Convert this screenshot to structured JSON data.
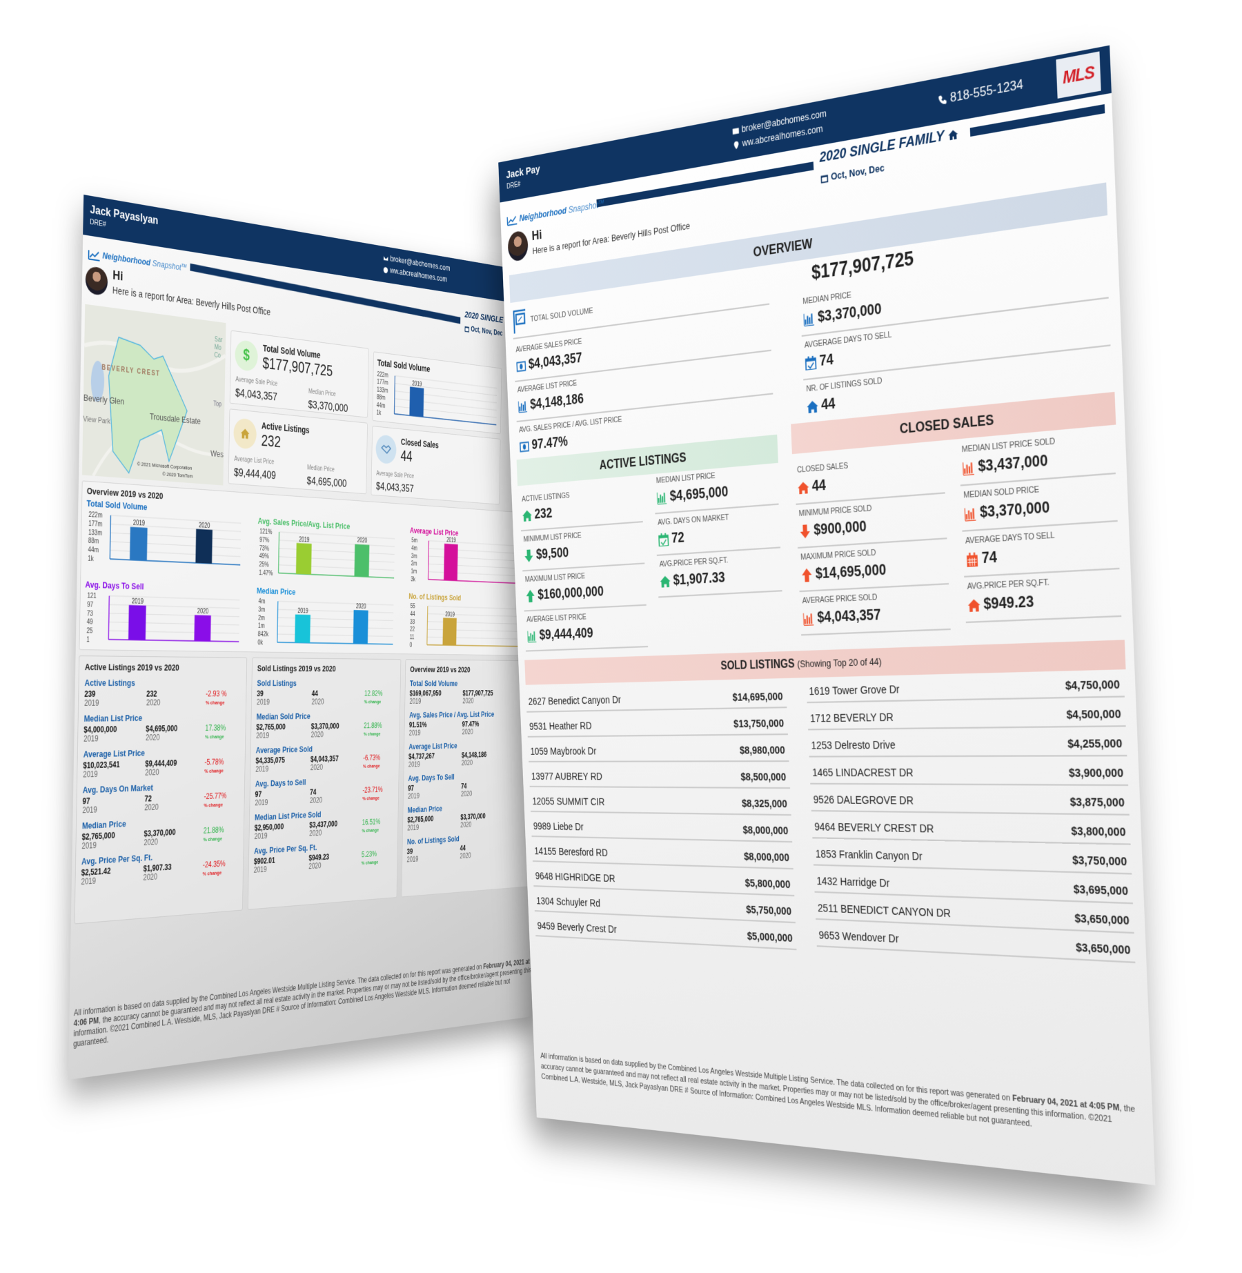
{
  "colors": {
    "navy": "#0f3462",
    "accent_blue": "#1a6fc0",
    "green": "#2bb673",
    "red": "#f0522d",
    "mls_red": "#d32027"
  },
  "left_doc": {
    "agent_name": "Jack Payaslyan",
    "dre": "DRE#",
    "email": "broker@abchomes.com",
    "website": "ww.abcrealhomes.com",
    "brand_a": "Neighborhood",
    "brand_b": "Snapshot",
    "brand_tm": "TM",
    "greeting": "Hi",
    "report_for": "Here is a report for Area: Beverly Hills Post Office",
    "report_title": "2020 SINGLE FAMIL",
    "period": "Oct, Nov, Dec",
    "map": {
      "labels": [
        "BEVERLY CREST",
        "Beverly Glen",
        "Trousdale Estate",
        "View Park",
        "Wes",
        "Top",
        "Sar",
        "Mo",
        "Co"
      ],
      "copyright_1": "© 2021 Microsoft Corporation",
      "copyright_2": "© 2020 TomTom"
    },
    "cards": {
      "total_sold": {
        "title": "Total Sold Volume",
        "value": "$177,907,725",
        "icon": "dollar",
        "sub": [
          {
            "label": "Average Sale Price",
            "value": "$4,043,357"
          },
          {
            "label": "Median Price",
            "value": "$3,370,000"
          }
        ]
      },
      "active": {
        "title": "Active Listings",
        "value": "232",
        "icon": "house",
        "sub": [
          {
            "label": "Average List Price",
            "value": "$9,444,409"
          },
          {
            "label": "Median Price",
            "value": "$4,695,000"
          }
        ]
      },
      "mini_chart": {
        "title": "Total Sold Volume",
        "ticks": [
          "222m",
          "177m",
          "133m",
          "88m",
          "44m",
          "1k"
        ],
        "ylim": [
          0,
          222000000
        ],
        "bars": [
          {
            "label": "2019",
            "value": 169067950,
            "color": "#1f5fae"
          }
        ]
      },
      "closed": {
        "title": "Closed Sales",
        "value": "44",
        "icon": "handshake",
        "sub": [
          {
            "label": "Average Sale Price",
            "value": "$4,043,357"
          }
        ]
      }
    },
    "charts": {
      "title": "Overview 2019 vs 2020",
      "items": [
        {
          "title": "Total Sold Volume",
          "color": "#1a6fc0",
          "ticks": [
            "222m",
            "177m",
            "133m",
            "88m",
            "44m",
            "1k"
          ],
          "ylim": [
            0,
            222000000
          ],
          "bars": [
            {
              "label": "2019",
              "value": 169067950,
              "color": "#2a78c2"
            },
            {
              "label": "2020",
              "value": 177907725,
              "color": "#0f2f57"
            }
          ]
        },
        {
          "title": "Avg. Sales Price/Avg. List Price",
          "color": "#4cbf6a",
          "ticks": [
            "121%",
            "97%",
            "73%",
            "49%",
            "25%",
            "1.47%"
          ],
          "ylim": [
            0,
            121
          ],
          "bars": [
            {
              "label": "2019",
              "value": 91.51,
              "color": "#9acd32"
            },
            {
              "label": "2020",
              "value": 97.47,
              "color": "#4cbf6a"
            }
          ]
        },
        {
          "title": "Average List Price",
          "color": "#d4109b",
          "ticks": [
            "5m",
            "4m",
            "3m",
            "2m",
            "1m",
            "3k"
          ],
          "ylim": [
            0,
            5000000
          ],
          "bars": [
            {
              "label": "2019",
              "value": 4737267,
              "color": "#d4109b"
            }
          ]
        },
        {
          "title": "Avg. Days To Sell",
          "color": "#8a0ee8",
          "ticks": [
            "121",
            "97",
            "73",
            "49",
            "25",
            "1"
          ],
          "ylim": [
            0,
            121
          ],
          "bars": [
            {
              "label": "2019",
              "value": 97,
              "color": "#7a0ee8"
            },
            {
              "label": "2020",
              "value": 74,
              "color": "#8a0ee8"
            }
          ]
        },
        {
          "title": "Median Price",
          "color": "#1a8fd8",
          "ticks": [
            "4m",
            "3m",
            "2m",
            "1m",
            "842k",
            "0k"
          ],
          "ylim": [
            0,
            4000000
          ],
          "bars": [
            {
              "label": "2019",
              "value": 2765000,
              "color": "#18c3d9"
            },
            {
              "label": "2020",
              "value": 3370000,
              "color": "#1a8fd8"
            }
          ]
        },
        {
          "title": "No. of Listings Sold",
          "color": "#c9a43b",
          "ticks": [
            "55",
            "44",
            "33",
            "22",
            "11",
            "0"
          ],
          "ylim": [
            0,
            55
          ],
          "bars": [
            {
              "label": "2019",
              "value": 39,
              "color": "#c9a43b"
            }
          ]
        }
      ]
    },
    "panels": [
      {
        "title": "Active Listings 2019 vs 2020",
        "rows": [
          {
            "label": "Active Listings",
            "a": "239",
            "b": "232",
            "change": "-2.93 %",
            "dir": "down"
          },
          {
            "label": "Median List Price",
            "a": "$4,000,000",
            "b": "$4,695,000",
            "change": "17.38%",
            "dir": "up"
          },
          {
            "label": "Average List Price",
            "a": "$10,023,541",
            "b": "$9,444,409",
            "change": "-5.78%",
            "dir": "down"
          },
          {
            "label": "Avg. Days On Market",
            "a": "97",
            "b": "72",
            "change": "-25.77%",
            "dir": "down"
          },
          {
            "label": "Median Price",
            "a": "$2,765,000",
            "b": "$3,370,000",
            "change": "21.88%",
            "dir": "up"
          },
          {
            "label": "Avg. Price Per Sq. Ft.",
            "a": "$2,521.42",
            "b": "$1,907.33",
            "change": "-24.35%",
            "dir": "down"
          }
        ]
      },
      {
        "title": "Sold Listings 2019 vs 2020",
        "rows": [
          {
            "label": "Sold Listings",
            "a": "39",
            "b": "44",
            "change": "12.82%",
            "dir": "up"
          },
          {
            "label": "Median Sold Price",
            "a": "$2,765,000",
            "b": "$3,370,000",
            "change": "21.88%",
            "dir": "up"
          },
          {
            "label": "Average Price Sold",
            "a": "$4,335,075",
            "b": "$4,043,357",
            "change": "-6.73%",
            "dir": "down"
          },
          {
            "label": "Avg. Days to Sell",
            "a": "97",
            "b": "74",
            "change": "-23.71%",
            "dir": "down"
          },
          {
            "label": "Median List Price Sold",
            "a": "$2,950,000",
            "b": "$3,437,000",
            "change": "16.51%",
            "dir": "up"
          },
          {
            "label": "Avg. Price Per Sq. Ft.",
            "a": "$902.01",
            "b": "$949.23",
            "change": "5.23%",
            "dir": "up"
          }
        ]
      },
      {
        "title": "Overview 2019 vs 2020",
        "rows": [
          {
            "label": "Total Sold Volume",
            "a": "$169,067,950",
            "b": "$177,907,725"
          },
          {
            "label": "Avg. Sales Price / Avg. List Price",
            "a": "91.51%",
            "b": "97.47%"
          },
          {
            "label": "Average List Price",
            "a": "$4,737,267",
            "b": "$4,148,186"
          },
          {
            "label": "Avg. Days To Sell",
            "a": "97",
            "b": "74"
          },
          {
            "label": "Median Price",
            "a": "$2,765,000",
            "b": "$3,370,000"
          },
          {
            "label": "No. of Listings Sold",
            "a": "39",
            "b": "44"
          }
        ]
      }
    ],
    "year_a": "2019",
    "year_b": "2020",
    "change_label": "% change",
    "footer": {
      "text_1": "All information is based on data supplied by the Combined Los Angeles Westside Multiple Listing Service. The data collected on for this report was generated on ",
      "date": "February 04, 2021 at 4:06 PM",
      "text_2": ", the accuracy cannot be guaranteed and may not reflect all real estate activity in the market. Properties may or may not be listed/sold by the office/broker/agent presenting this information. ©2021 Combined L.A. Westside, MLS, Jack Payaslyan DRE # Source of Information: Combined Los Angeles Westside MLS. Information deemed reliable but not guaranteed."
    }
  },
  "right_doc": {
    "agent_name": "Jack Pay",
    "dre": "DRE#",
    "email": "broker@abchomes.com",
    "website": "ww.abcrealhomes.com",
    "phone": "818-555-1234",
    "logo_text": "MLS",
    "brand_a": "Neighborhood",
    "brand_b": "Snapshot",
    "brand_tm": "TM",
    "greeting": "Hi",
    "report_for": "Here is a report for Area: Beverly Hills Post Office",
    "report_title": "2020 SINGLE FAMILY",
    "period": "Oct, Nov, Dec",
    "overview": {
      "title": "OVERVIEW",
      "total_label": "TOTAL SOLD VOLUME",
      "total_value": "$177,907,725",
      "left": [
        {
          "label": "AVERAGE SALES PRICE",
          "value": "$4,043,357",
          "icon": "money"
        },
        {
          "label": "AVERAGE LIST PRICE",
          "value": "$4,148,186",
          "icon": "bar-chart"
        },
        {
          "label": "AVG. SALES PRICE / AVG. LIST PRICE",
          "value": "97.47%",
          "icon": "money"
        }
      ],
      "right": [
        {
          "label": "MEDIAN PRICE",
          "value": "$3,370,000",
          "icon": "bar-chart"
        },
        {
          "label": "AVGERAGE DAYS TO SELL",
          "value": "74",
          "icon": "calendar-check"
        },
        {
          "label": "NR. OF LISTINGS SOLD",
          "value": "44",
          "icon": "house"
        }
      ]
    },
    "active": {
      "title": "ACTIVE LISTINGS",
      "col1": [
        {
          "label": "ACTIVE LISTINGS",
          "value": "232",
          "icon": "house"
        },
        {
          "label": "MINIMUM LIST PRICE",
          "value": "$9,500",
          "icon": "arrow-down"
        },
        {
          "label": "MAXIMUM LIST PRICE",
          "value": "$160,000,000",
          "icon": "arrow-up"
        },
        {
          "label": "AVERAGE LIST PRICE",
          "value": "$9,444,409",
          "icon": "bar-chart"
        }
      ],
      "col2": [
        {
          "label": "MEDIAN LIST PRICE",
          "value": "$4,695,000",
          "icon": "bar-chart"
        },
        {
          "label": "AVG. DAYS ON MARKET",
          "value": "72",
          "icon": "calendar-check"
        },
        {
          "label": "AVG.PRICE PER SQ.FT.",
          "value": "$1,907.33",
          "icon": "house"
        }
      ]
    },
    "closed": {
      "title": "CLOSED SALES",
      "col1": [
        {
          "label": "CLOSED SALES",
          "value": "44",
          "icon": "house"
        },
        {
          "label": "MINIMUM PRICE SOLD",
          "value": "$900,000",
          "icon": "arrow-down"
        },
        {
          "label": "MAXIMUM PRICE SOLD",
          "value": "$14,695,000",
          "icon": "arrow-up"
        },
        {
          "label": "AVERAGE PRICE SOLD",
          "value": "$4,043,357",
          "icon": "bar-chart"
        }
      ],
      "col2": [
        {
          "label": "MEDIAN LIST PRICE SOLD",
          "value": "$3,437,000",
          "icon": "bar-chart"
        },
        {
          "label": "MEDIAN SOLD PRICE",
          "value": "$3,370,000",
          "icon": "bar-chart"
        },
        {
          "label": "AVERAGE DAYS TO SELL",
          "value": "74",
          "icon": "calendar"
        },
        {
          "label": "AVG.PRICE PER SQ.FT.",
          "value": "$949.23",
          "icon": "house"
        }
      ]
    },
    "sold": {
      "title": "SOLD LISTINGS",
      "subtitle": "(Showing Top 20 of 44)",
      "left": [
        {
          "address": "2627 Benedict Canyon Dr",
          "price": "$14,695,000"
        },
        {
          "address": "9531 Heather RD",
          "price": "$13,750,000"
        },
        {
          "address": "1059 Maybrook Dr",
          "price": "$8,980,000"
        },
        {
          "address": "13977 AUBREY RD",
          "price": "$8,500,000"
        },
        {
          "address": "12055 SUMMIT CIR",
          "price": "$8,325,000"
        },
        {
          "address": "9989 Liebe Dr",
          "price": "$8,000,000"
        },
        {
          "address": "14155 Beresford RD",
          "price": "$8,000,000"
        },
        {
          "address": "9648 HIGHRIDGE DR",
          "price": "$5,800,000"
        },
        {
          "address": "1304 Schuyler Rd",
          "price": "$5,750,000"
        },
        {
          "address": "9459 Beverly Crest Dr",
          "price": "$5,000,000"
        }
      ],
      "right": [
        {
          "address": "1619 Tower Grove Dr",
          "price": "$4,750,000"
        },
        {
          "address": "1712 BEVERLY DR",
          "price": "$4,500,000"
        },
        {
          "address": "1253 Delresto Drive",
          "price": "$4,255,000"
        },
        {
          "address": "1465 LINDACREST DR",
          "price": "$3,900,000"
        },
        {
          "address": "9526 DALEGROVE DR",
          "price": "$3,875,000"
        },
        {
          "address": "9464 BEVERLY CREST DR",
          "price": "$3,800,000"
        },
        {
          "address": "1853 Franklin Canyon Dr",
          "price": "$3,750,000"
        },
        {
          "address": "1432 Harridge Dr",
          "price": "$3,695,000"
        },
        {
          "address": "2511 BENEDICT CANYON DR",
          "price": "$3,650,000"
        },
        {
          "address": "9653 Wendover Dr",
          "price": "$3,650,000"
        }
      ]
    },
    "footer": {
      "text_1": "All information is based on data supplied by the Combined Los Angeles Westside Multiple Listing Service. The data collected on for this report was generated on ",
      "date": "February 04, 2021 at 4:05 PM",
      "text_2": ", the accuracy cannot be guaranteed and may not reflect all real estate activity in the market. Properties may or may not be listed/sold by the office/broker/agent presenting this information. ©2021 Combined L.A. Westside, MLS, Jack Payaslyan DRE # Source of Information: Combined Los Angeles Westside MLS. Information deemed reliable but not guaranteed."
    }
  }
}
